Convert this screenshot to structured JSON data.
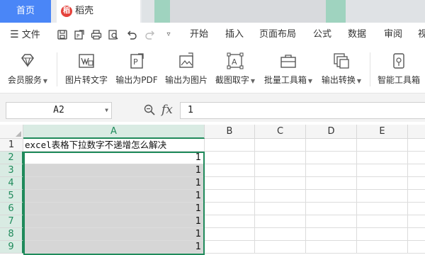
{
  "tabs": {
    "home_label": "首页",
    "doc_label": "稻壳",
    "doc_logo_glyph": "稻"
  },
  "menu": {
    "file_label": "文件",
    "items": [
      "开始",
      "插入",
      "页面布局",
      "公式",
      "数据",
      "审阅",
      "视"
    ]
  },
  "ribbon": {
    "buttons": [
      {
        "icon": "diamond-icon",
        "label": "会员服务",
        "has_caret": true
      },
      {
        "icon": "image-to-text-icon",
        "label": "图片转文字",
        "has_caret": false
      },
      {
        "icon": "export-pdf-icon",
        "label": "输出为PDF",
        "has_caret": false
      },
      {
        "icon": "export-image-icon",
        "label": "输出为图片",
        "has_caret": false
      },
      {
        "icon": "screenshot-ocr-icon",
        "label": "截图取字",
        "has_caret": true
      },
      {
        "icon": "toolbox-icon",
        "label": "批量工具箱",
        "has_caret": true
      },
      {
        "icon": "convert-icon",
        "label": "输出转换",
        "has_caret": true
      },
      {
        "icon": "smart-toolbox-icon",
        "label": "智能工具箱",
        "has_caret": false
      }
    ]
  },
  "formula_bar": {
    "cell_ref": "A2",
    "fx_label": "fx",
    "value": "1"
  },
  "sheet": {
    "columns": [
      "A",
      "B",
      "C",
      "D",
      "E"
    ],
    "rows": [
      "1",
      "2",
      "3",
      "4",
      "5",
      "6",
      "7",
      "8",
      "9"
    ],
    "a1_text": "excel表格下拉数字不递增怎么解决",
    "column_a_values": [
      "1",
      "1",
      "1",
      "1",
      "1",
      "1",
      "1",
      "1"
    ]
  },
  "colors": {
    "accent_tab": "#4a86f7",
    "selection_green": "#1f8a5b",
    "selection_fill": "#d6d6d6"
  }
}
